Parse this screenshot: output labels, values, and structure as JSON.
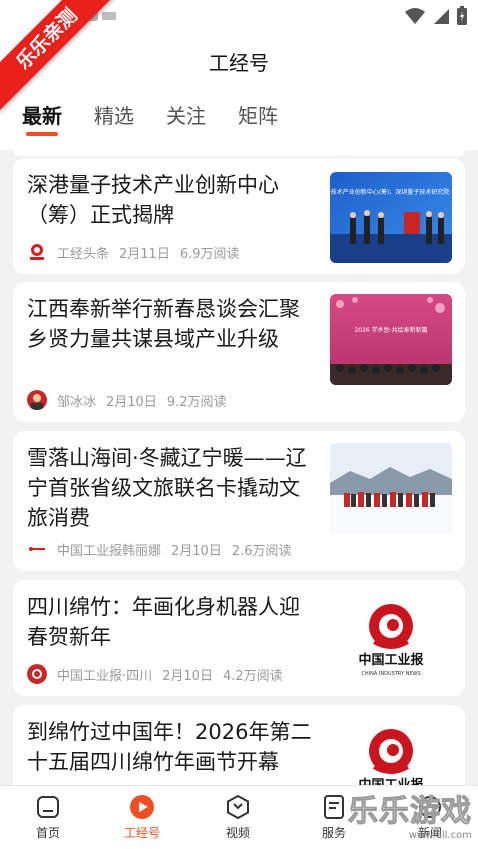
{
  "page": {
    "title": "工经号",
    "tabs": [
      "最新",
      "精选",
      "关注",
      "矩阵"
    ],
    "active_tab": "最新"
  },
  "articles": [
    {
      "title": "深港量子技术产业创新中心（筹）正式揭牌",
      "source": "工经头条",
      "date": "2月11日",
      "reads": "6.9万阅读",
      "thumb_text": "深港量子技术产业创新中心(筹)、深圳量子技术研究院 揭牌仪式"
    },
    {
      "title": "江西奉新举行新春恳谈会汇聚乡贤力量共谋县域产业升级",
      "source": "邹冰冰",
      "date": "2月10日",
      "reads": "9.2万阅读",
      "thumb_text": "2026 学乡愁·共绘奉新新篇"
    },
    {
      "title": "雪落山海间·冬藏辽宁暖——辽宁首张省级文旅联名卡撬动文旅消费",
      "source": "中国工业报韩丽娜",
      "date": "2月10日",
      "reads": "2.6万阅读"
    },
    {
      "title": "四川绵竹：年画化身机器人迎春贺新年",
      "source": "中国工业报·四川",
      "date": "2月10日",
      "reads": "4.2万阅读",
      "thumb_text": "中国工业报",
      "thumb_subtext": "CHINA INDUSTRY NEWS"
    },
    {
      "title": "到绵竹过中国年！2026年第二十五届四川绵竹年画节开幕",
      "thumb_text": "中国工业报"
    }
  ],
  "nav": [
    {
      "label": "首页",
      "icon": "home-icon"
    },
    {
      "label": "工经号",
      "icon": "play-icon"
    },
    {
      "label": "视频",
      "icon": "video-icon"
    },
    {
      "label": "服务",
      "icon": "service-icon"
    },
    {
      "label": "新闻",
      "icon": "news-icon"
    }
  ],
  "overlay": {
    "ribbon": "乐乐亲测",
    "watermark": "乐乐游戏",
    "watermark_url": "www.6ll.com"
  },
  "colors": {
    "accent": "#f04e23",
    "background": "#f2f2f2",
    "card": "#ffffff",
    "meta_text": "#9a9a9a",
    "ribbon": "#e8211b"
  }
}
